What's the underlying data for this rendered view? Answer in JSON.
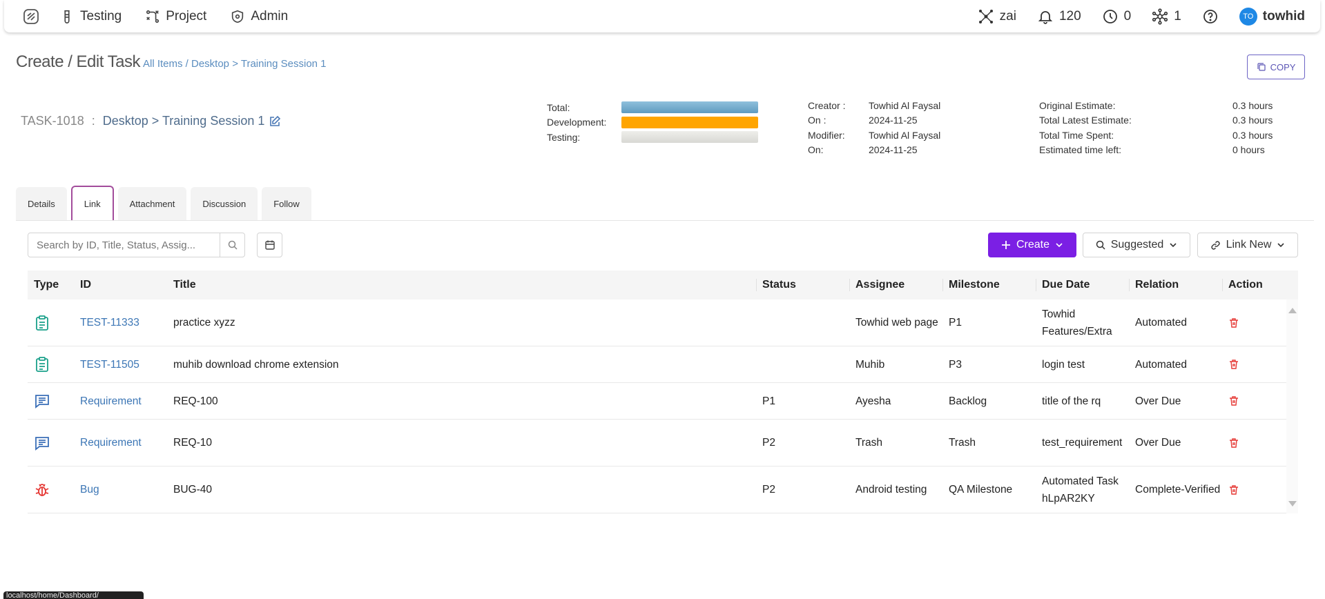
{
  "nav": {
    "items": [
      {
        "label": "Testing",
        "icon": "flask-icon"
      },
      {
        "label": "Project",
        "icon": "project-icon"
      },
      {
        "label": "Admin",
        "icon": "shield-icon"
      }
    ],
    "right": {
      "zai_label": "zai",
      "notifications_count": "120",
      "clock_count": "0",
      "network_count": "1",
      "avatar_initials": "TO",
      "user_name": "towhid"
    }
  },
  "header": {
    "title": "Create / Edit Task",
    "breadcrumb": "All Items / Desktop > Training Session 1",
    "copy_label": "COPY"
  },
  "task": {
    "id": "TASK-1018",
    "separator": " : ",
    "name": "Desktop > Training Session 1"
  },
  "progress": {
    "rows": [
      {
        "label": "Total:",
        "color": "#75aed0"
      },
      {
        "label": "Development:",
        "color": "#ffa500"
      },
      {
        "label": "Testing:",
        "color": "#e4e4e0"
      }
    ]
  },
  "meta_left": [
    {
      "key": "Creator :",
      "value": "Towhid Al Faysal"
    },
    {
      "key": "On :",
      "value": "2024-11-25"
    },
    {
      "key": "Modifier:",
      "value": "Towhid Al Faysal"
    },
    {
      "key": "On:",
      "value": "2024-11-25"
    }
  ],
  "meta_right": [
    {
      "key": "Original Estimate:",
      "value": "0.3 hours"
    },
    {
      "key": "Total Latest Estimate:",
      "value": "0.3 hours"
    },
    {
      "key": "Total Time Spent:",
      "value": "0.3 hours"
    },
    {
      "key": "Estimated time left:",
      "value": "0 hours"
    }
  ],
  "tabs": [
    "Details",
    "Link",
    "Attachment",
    "Discussion",
    "Follow"
  ],
  "active_tab": "Link",
  "toolbar": {
    "search_placeholder": "Search by ID, Title, Status, Assig...",
    "create_label": "Create",
    "suggested_label": "Suggested",
    "link_new_label": "Link New"
  },
  "table": {
    "columns": [
      "Type",
      "ID",
      "Title",
      "Status",
      "Assignee",
      "Milestone",
      "Due Date",
      "Relation",
      "Action"
    ],
    "rows": [
      {
        "type_icon": "test-case-icon",
        "id": "TEST-11333",
        "title": "practice xyzz",
        "status": "",
        "assignee": "Towhid web page",
        "milestone": "P1",
        "due_date": "Towhid Features/Extra",
        "relation": "Automated"
      },
      {
        "type_icon": "test-case-icon",
        "id": "TEST-11505",
        "title": "muhib download chrome extension",
        "status": "",
        "assignee": "Muhib",
        "milestone": "P3",
        "due_date": "login test",
        "relation": "Automated"
      },
      {
        "type_icon": "requirement-icon",
        "id": "Requirement",
        "title": "REQ-100",
        "status": "P1",
        "assignee": "Ayesha",
        "milestone": "Backlog",
        "due_date": "title of the rq",
        "relation": "Over Due"
      },
      {
        "type_icon": "requirement-icon",
        "id": "Requirement",
        "title": "REQ-10",
        "status": "P2",
        "assignee": "Trash",
        "milestone": "Trash",
        "due_date": "test_requirement",
        "relation": "Over Due"
      },
      {
        "type_icon": "bug-icon",
        "id": "Bug",
        "title": "BUG-40",
        "status": "P2",
        "assignee": "Android testing",
        "milestone": "QA Milestone",
        "due_date": "Automated Task hLpAR2KY",
        "relation": "Complete-Verified"
      }
    ]
  },
  "status_bar": "localhost/home/Dashboard/",
  "colors": {
    "accent": "#7b1fe4",
    "link": "#3c76b5",
    "tab_active_border": "#a24c9b",
    "delete": "#e53935"
  }
}
